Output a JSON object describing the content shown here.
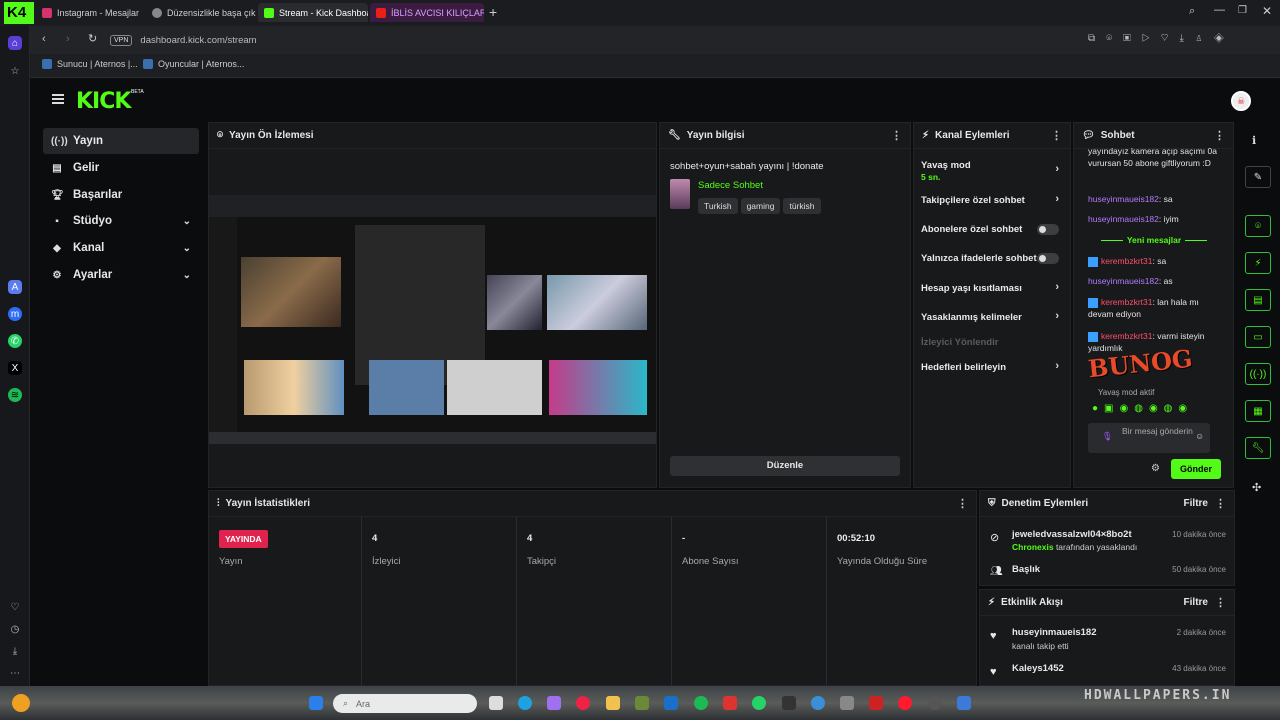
{
  "browser": {
    "tabs": [
      {
        "label": "Instagram - Mesajlar"
      },
      {
        "label": "Düzensizlikle başa çıkma"
      },
      {
        "label": "Stream - Kick Dashboard"
      },
      {
        "label": "İBLİS AVCISI KILIÇLAR"
      }
    ],
    "new_tab": "+",
    "vpn": "VPN",
    "url": "dashboard.kick.com/stream",
    "bookmarks": [
      {
        "label": "Sunucu | Aternos |..."
      },
      {
        "label": "Oyuncular | Aternos..."
      }
    ]
  },
  "kick": {
    "logo": "KICK",
    "beta": "BETA",
    "nav": [
      {
        "label": "Yayın",
        "icon": "broadcast-icon"
      },
      {
        "label": "Gelir",
        "icon": "wallet-icon"
      },
      {
        "label": "Başarılar",
        "icon": "trophy-icon"
      },
      {
        "label": "Stüdyo",
        "icon": "studio-icon"
      },
      {
        "label": "Kanal",
        "icon": "channel-icon"
      },
      {
        "label": "Ayarlar",
        "icon": "settings-icon"
      }
    ],
    "preview": {
      "title": "Yayın Ön İzlemesi"
    },
    "info": {
      "title": "Yayın bilgisi",
      "stream_title": "sohbet+oyun+sabah yayını | !donate",
      "category": "Sadece Sohbet",
      "tags": [
        "Turkish",
        "gaming",
        "türkish"
      ],
      "edit_button": "Düzenle"
    },
    "actions": {
      "title": "Kanal Eylemleri",
      "slow_mode": "Yavaş mod",
      "slow_mode_value": "5 sn.",
      "followers_only": "Takipçilere özel sohbet",
      "subscribers_only": "Abonelere özel sohbet",
      "emotes_only": "Yalnızca ifadelerle sohbet",
      "account_age": "Hesap yaşı kısıtlaması",
      "banned_words": "Yasaklanmış kelimeler",
      "viewer_redirect": "İzleyici Yönlendir",
      "goals": "Hedefleri belirleyin"
    },
    "chat": {
      "title": "Sohbet",
      "lines": [
        {
          "user": "",
          "text": "yayındayız kamera açıp saçımı 0a vurursan 50 abone giftliyorum :D"
        },
        {
          "user": "huseyinmaueis182",
          "text": ": sa"
        },
        {
          "user": "huseyinmaueis182",
          "text": ": iyim"
        },
        {
          "user": "kerembzkrt31",
          "text": ": sa"
        },
        {
          "user": "huseyinmaueis182",
          "text": ": as"
        },
        {
          "user": "kerembzkrt31",
          "text": ": lan hala mı devam ediyon"
        },
        {
          "user": "kerembzkrt31",
          "text": ": varmi isteyin yardımlık"
        }
      ],
      "new_messages": "Yeni mesajlar",
      "slow_mode_notice": "Yavaş mod aktif",
      "input_placeholder": "Bir mesaj gönderin",
      "send": "Gönder"
    },
    "stats": {
      "title": "Yayın İstatistikleri",
      "live_badge": "YAYINDA",
      "items": [
        {
          "value": "",
          "label": "Yayın"
        },
        {
          "value": "4",
          "label": "İzleyici"
        },
        {
          "value": "4",
          "label": "Takipçi"
        },
        {
          "value": "-",
          "label": "Abone Sayısı"
        },
        {
          "value": "00:52:10",
          "label": "Yayında Olduğu Süre"
        }
      ]
    },
    "moderation": {
      "title": "Denetim Eylemleri",
      "filter": "Filtre",
      "items": [
        {
          "user": "jeweledvassalzwl04×8bo2t",
          "detail_user": "Chronexis",
          "detail": " tarafından yasaklandı",
          "time": "10 dakika önce"
        },
        {
          "user": "Başlık",
          "detail_user": "",
          "detail": "",
          "time": "50 dakika önce"
        }
      ]
    },
    "activity": {
      "title": "Etkinlik Akışı",
      "filter": "Filtre",
      "items": [
        {
          "user": "huseyinmaueis182",
          "detail": "kanalı takip etti",
          "time": "2 dakika önce"
        },
        {
          "user": "Kaleys1452",
          "detail": "",
          "time": "43 dakika önce"
        }
      ]
    }
  },
  "taskbar": {
    "search_placeholder": "Ara"
  },
  "watermark": "HDWALLPAPERS.IN",
  "overlay_brand": "BUNOG",
  "colors": {
    "kick_green": "#53fc18",
    "live_red": "#e0234e",
    "chat_user": "#b17cff"
  }
}
